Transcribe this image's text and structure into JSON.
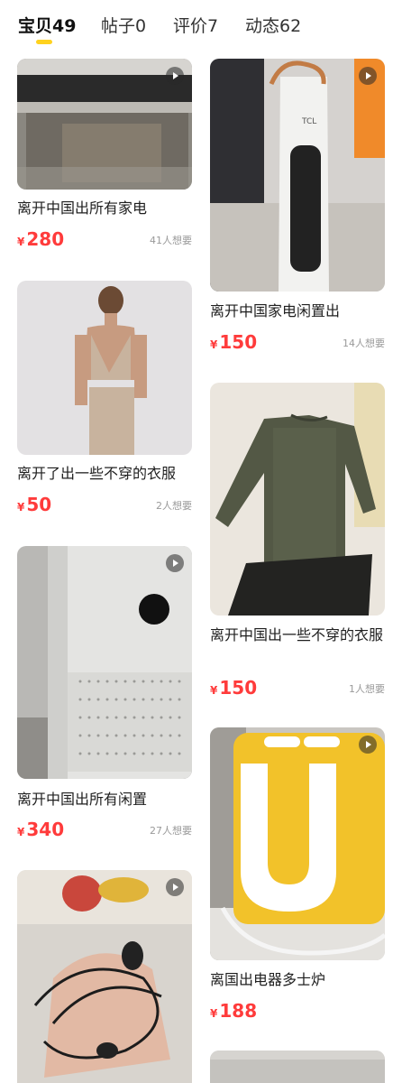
{
  "tabs": [
    {
      "label": "宝贝49"
    },
    {
      "label": "帖子0"
    },
    {
      "label": "评价7"
    },
    {
      "label": "动态62"
    }
  ],
  "currency_symbol": "¥",
  "items": [
    {
      "title": "离开中国出所有家电",
      "price": "280",
      "wants": "41人想要",
      "video": true
    },
    {
      "title": "离开了出一些不穿的衣服",
      "price": "50",
      "wants": "2人想要",
      "video": false
    },
    {
      "title": "离开中国出所有闲置",
      "price": "340",
      "wants": "27人想要",
      "video": true
    },
    {
      "title": "",
      "price": "",
      "wants": "",
      "video": true
    },
    {
      "title": "离开中国家电闲置出",
      "price": "150",
      "wants": "14人想要",
      "video": true
    },
    {
      "title": "离开中国出一些不穿的衣服",
      "price": "150",
      "wants": "1人想要",
      "video": false
    },
    {
      "title": "离国出电器多士炉",
      "price": "188",
      "wants": "",
      "video": true
    },
    {
      "title": "",
      "price": "",
      "wants": "",
      "video": false
    }
  ]
}
